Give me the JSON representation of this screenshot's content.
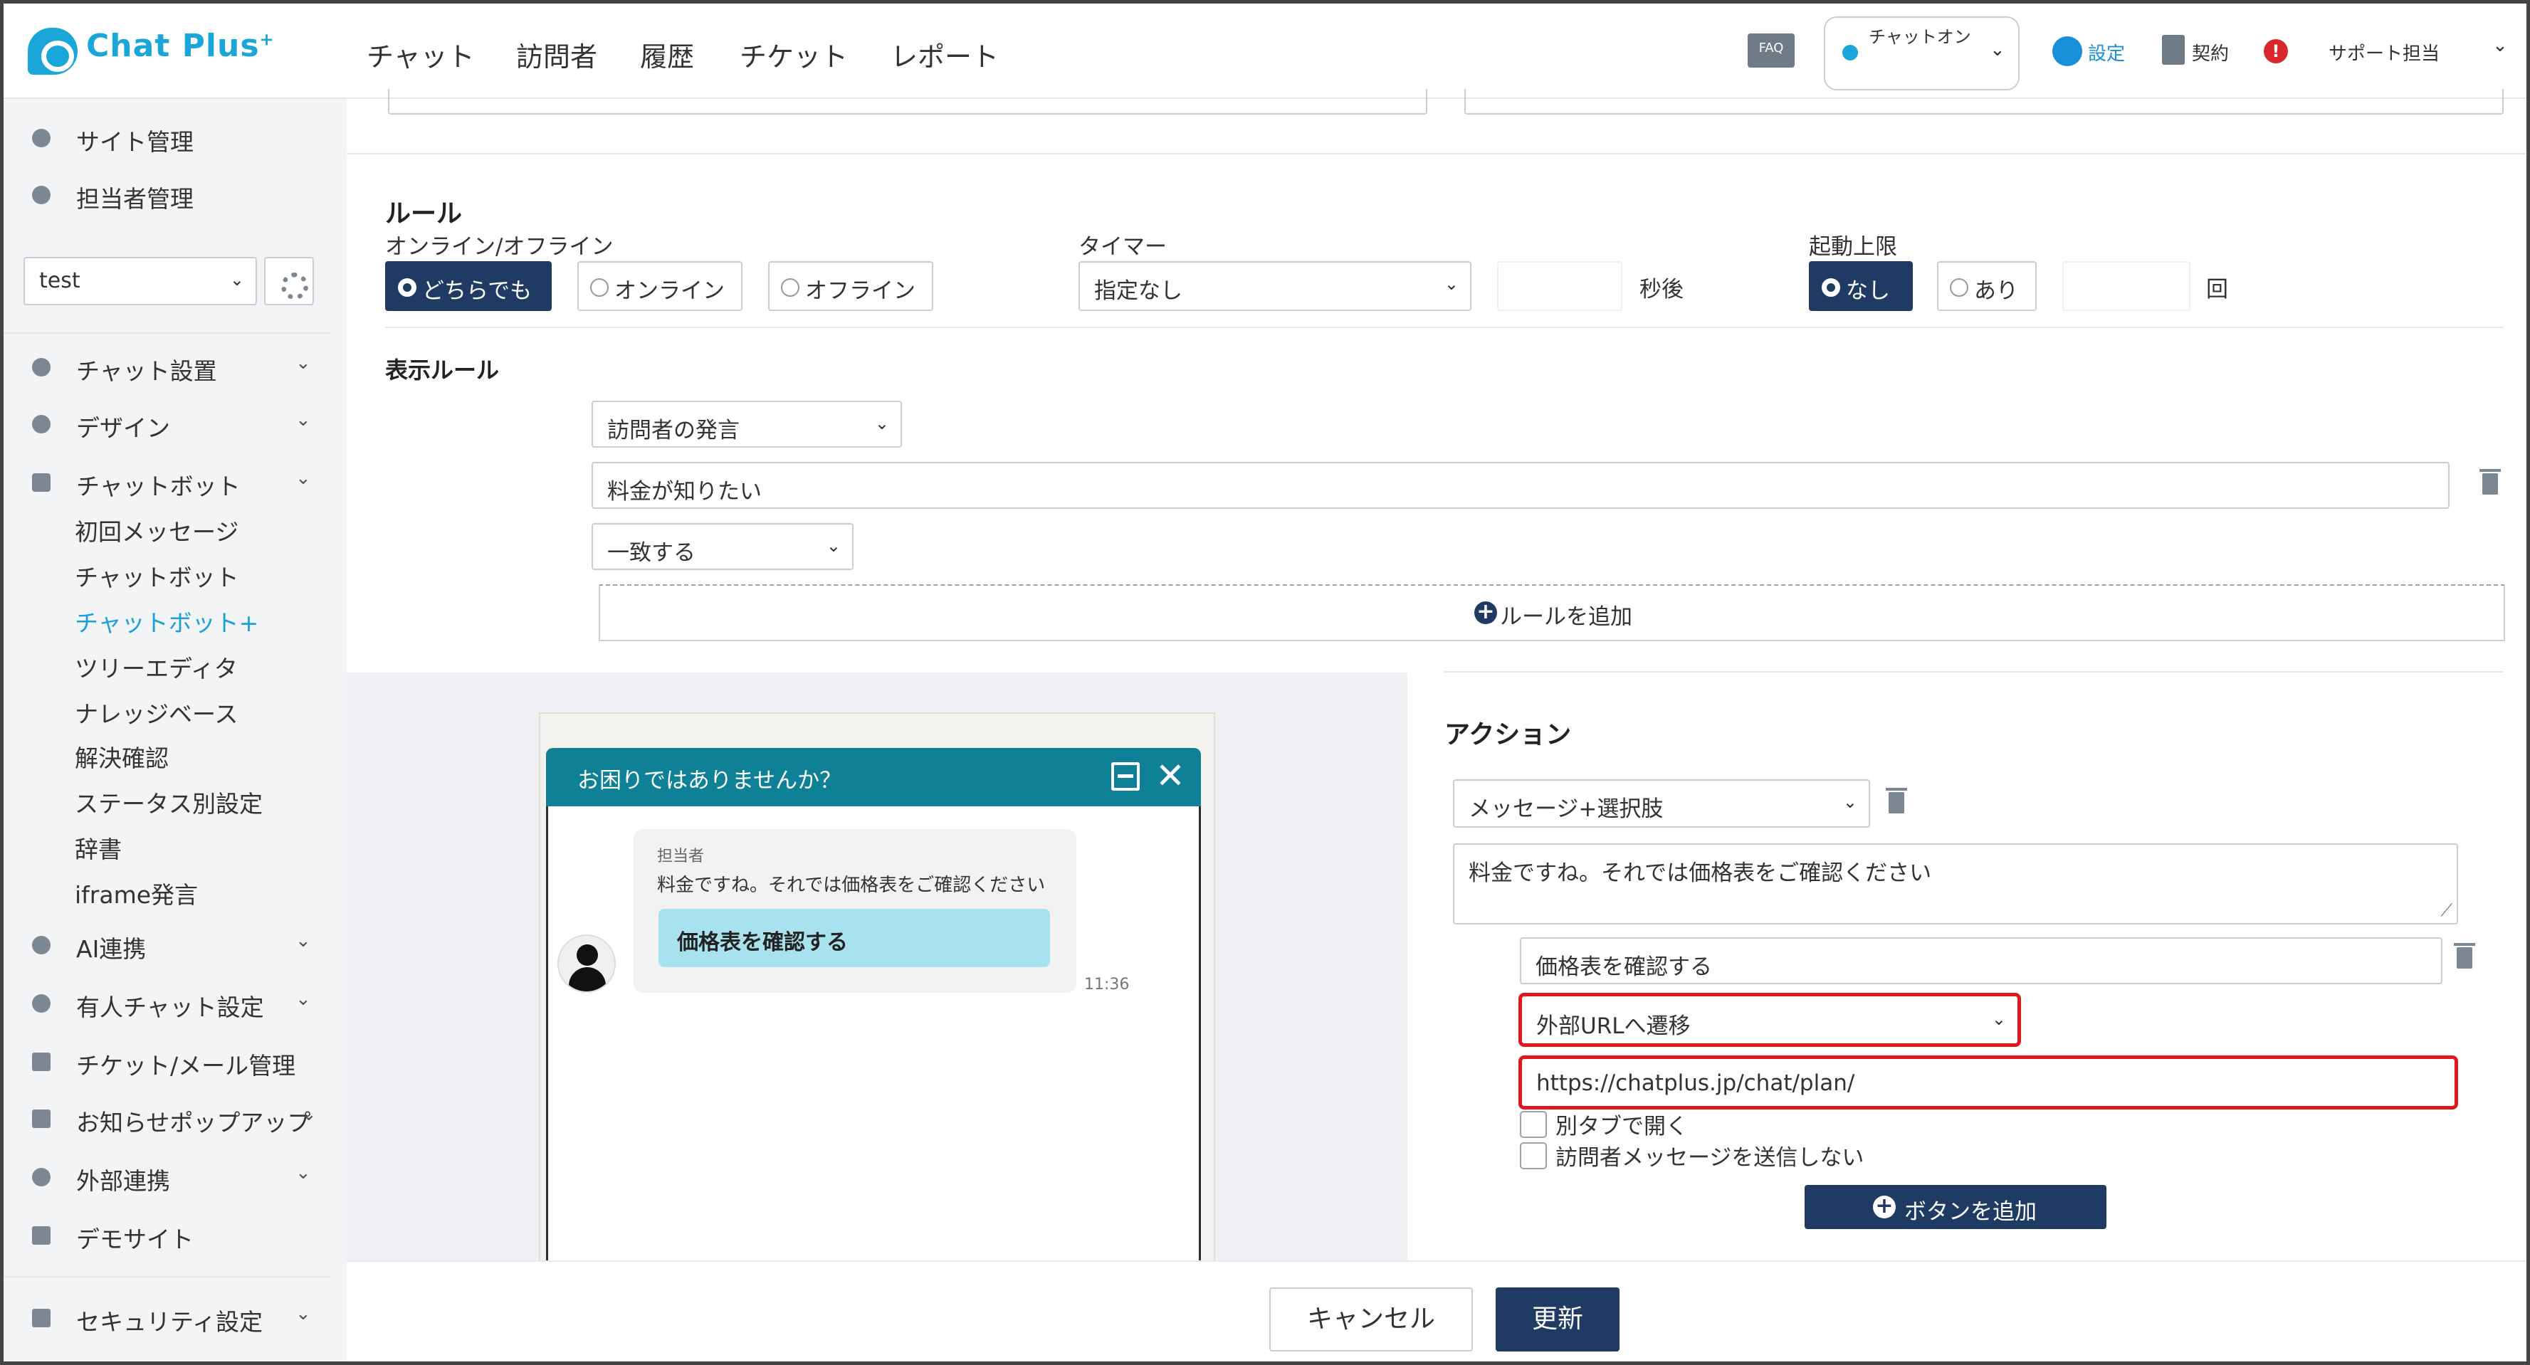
{
  "header": {
    "logo": "Chat Plus",
    "logo_sup": "+",
    "nav": [
      "チャット",
      "訪問者",
      "履歴",
      "チケット",
      "レポート"
    ],
    "faq": "FAQ",
    "status": "チャットオン",
    "settings": "設定",
    "contract": "契約",
    "alert": "!",
    "user": "サポート担当"
  },
  "sidebar": {
    "top_items": [
      {
        "label": "サイト管理",
        "icon": "gear-icon"
      },
      {
        "label": "担当者管理",
        "icon": "users-icon"
      }
    ],
    "site_select": "test",
    "sections": [
      {
        "label": "チャット設置",
        "icon": "tools-icon"
      },
      {
        "label": "デザイン",
        "icon": "palette-icon"
      },
      {
        "label": "チャットボット",
        "icon": "chat-icon"
      }
    ],
    "bot_sub": [
      "初回メッセージ",
      "チャットボット",
      "チャットボット+",
      "ツリーエディタ",
      "ナレッジベース",
      "解決確認",
      "ステータス別設定",
      "辞書",
      "iframe発言"
    ],
    "bottom_sections": [
      {
        "label": "AI連携",
        "icon": "ai-icon"
      },
      {
        "label": "有人チャット設定",
        "icon": "operator-icon"
      },
      {
        "label": "チケット/メール管理",
        "icon": "ticket-icon"
      },
      {
        "label": "お知らせポップアップ",
        "icon": "popup-icon"
      },
      {
        "label": "外部連携",
        "icon": "share-icon"
      },
      {
        "label": "デモサイト",
        "icon": "demo-icon"
      },
      {
        "label": "セキュリティ設定",
        "icon": "security-icon"
      }
    ]
  },
  "rule": {
    "title": "ルール",
    "online_label": "オンライン/オフライン",
    "online_opts": [
      "どちらでも",
      "オンライン",
      "オフライン"
    ],
    "timer_label": "タイマー",
    "timer_value": "指定なし",
    "timer_unit": "秒後",
    "limit_label": "起動上限",
    "limit_opts": [
      "なし",
      "あり"
    ],
    "limit_unit": "回",
    "display_title": "表示ルール",
    "display_type": "訪問者の発言",
    "display_text": "料金が知りたい",
    "display_match": "一致する",
    "add_rule": "ルールを追加"
  },
  "preview": {
    "title": "お困りではありませんか？",
    "agent": "担当者",
    "message": "料金ですね。それでは価格表をご確認ください",
    "button": "価格表を確認する",
    "time": "11:36"
  },
  "action": {
    "title": "アクション",
    "type": "メッセージ+選択肢",
    "message": "料金ですね。それでは価格表をご確認ください",
    "button_label": "価格表を確認する",
    "button_action": "外部URLへ遷移",
    "url": "https://chatplus.jp/chat/plan/",
    "new_tab": "別タブで開く",
    "no_send": "訪問者メッセージを送信しない",
    "add_button": "ボタンを追加"
  },
  "footer": {
    "cancel": "キャンセル",
    "update": "更新"
  }
}
